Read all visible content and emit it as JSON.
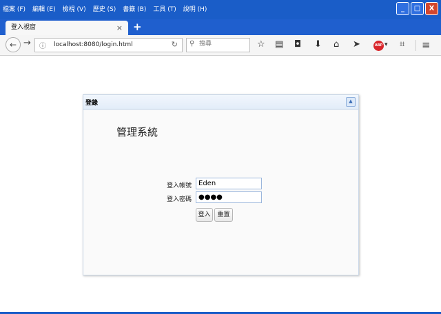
{
  "menu": [
    "檔案 (F)",
    "編輯 (E)",
    "檢視 (V)",
    "歷史 (S)",
    "書籤 (B)",
    "工具 (T)",
    "說明 (H)"
  ],
  "window": {
    "minimize": "_",
    "maximize": "□",
    "close": "X"
  },
  "tab": {
    "title": "登入視窗",
    "close": "×",
    "new": "+"
  },
  "nav": {
    "back": "←",
    "forward": "→",
    "info": "ⓘ",
    "url": "localhost:8080/login.html",
    "reload": "↻"
  },
  "search": {
    "icon": "⚲",
    "placeholder": "搜尋"
  },
  "toolbar_icons": [
    "star-icon",
    "reading-list-icon",
    "pocket-icon",
    "download-icon",
    "home-icon",
    "send-icon",
    "adblock-icon",
    "crop-icon",
    "menu-icon"
  ],
  "toolbar": {
    "star": "☆",
    "reading": "▤",
    "pocket": "◘",
    "download": "⬇",
    "home": "⌂",
    "send": "➤",
    "abp": "ABP",
    "abp_arrow": "▾",
    "crop": "⌗",
    "menu": "≡"
  },
  "panel": {
    "title": "登錄",
    "collapse": "▲",
    "heading": "管理系統",
    "username_label": "登入帳號",
    "username_value": "Eden",
    "password_label": "登入密碼",
    "password_value": "●●●●",
    "login_button": "登入",
    "reset_button": "重置"
  },
  "colors": {
    "titlebar": "#1a5dc8",
    "panel_border": "#c8d6e6",
    "input_border": "#9bb6dc",
    "close_button": "#d2462d"
  }
}
